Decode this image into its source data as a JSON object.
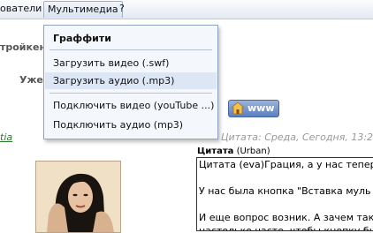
{
  "menubar": {
    "items": [
      {
        "label": "ователи"
      },
      {
        "label": "Мультимедиа"
      },
      {
        "label": "?"
      }
    ]
  },
  "background": {
    "label_left_1": "тройкен",
    "label_left_2": "Уже",
    "link_fragment": "tia",
    "post_meta": "Цитата: Среда, Сегодня, 13:20 |",
    "www_button": "www"
  },
  "dropdown": {
    "header": "Граффити",
    "items": [
      {
        "label": "Загрузить видео (.swf)"
      },
      {
        "label": "Загрузить аудио (.mp3)"
      },
      {
        "label": "Подключить видео (youTube ...)"
      },
      {
        "label": "Подключить аудио (mp3)"
      }
    ]
  },
  "post": {
    "quote_title": "Цитата",
    "quote_author": "(Urban)",
    "lines": [
      "Цитата (eva)Грация, а у нас тепер",
      "",
      "У нас была кнопка \"Вставка муль",
      "",
      "И еще вопрос возник. А зачем так",
      "настолько часто, чтобы кнопку был"
    ]
  }
}
